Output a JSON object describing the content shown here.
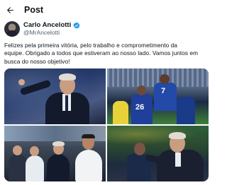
{
  "header": {
    "title": "Post"
  },
  "author": {
    "name": "Carlo Ancelotti",
    "handle": "@MrAncelotti"
  },
  "post": {
    "lines": [
      "Felizes pela primeira vitória, pelo trabalho e comprometimento da",
      "equipe. Obrigado a todos que estiveram ao nosso lado. Vamos juntos em",
      "busca do nosso objetivo!"
    ]
  },
  "media": {
    "photo2": {
      "jersey_left": "26",
      "jersey_right": "7"
    }
  },
  "colors": {
    "verified": "#1d9bf0",
    "secondary_text": "#536471"
  }
}
